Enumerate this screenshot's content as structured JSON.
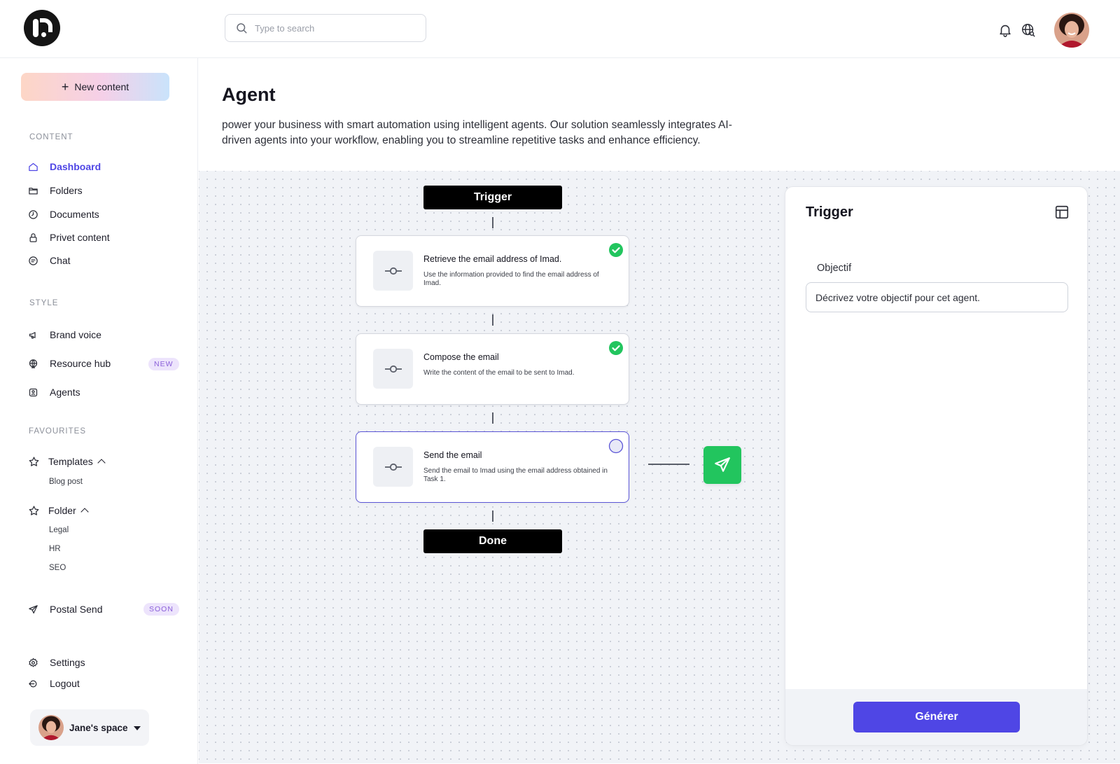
{
  "search": {
    "placeholder": "Type to search"
  },
  "sidebar": {
    "new_content_label": "New content",
    "sections": {
      "content": "CONTENT",
      "style": "STYLE",
      "favourites": "FAVOURITES"
    },
    "content_items": [
      "Dashboard",
      "Folders",
      "Documents",
      "Privet content",
      "Chat"
    ],
    "style_items": [
      "Brand voice",
      "Resource hub",
      "Agents"
    ],
    "resource_hub_badge": "NEW",
    "favourites": {
      "templates": {
        "label": "Templates",
        "children": [
          "Blog post"
        ]
      },
      "folder": {
        "label": "Folder",
        "children": [
          "Legal",
          "HR",
          "SEO"
        ]
      }
    },
    "postal_send": {
      "label": "Postal Send",
      "badge": "SOON"
    },
    "settings_label": "Settings",
    "logout_label": "Logout",
    "space_name": "Jane's space"
  },
  "main": {
    "title": "Agent",
    "description": "power your business with smart automation using intelligent agents. Our solution seamlessly integrates AI-driven agents into your workflow, enabling you to streamline repetitive tasks and enhance efficiency."
  },
  "workflow": {
    "trigger_label": "Trigger",
    "done_label": "Done",
    "steps": [
      {
        "title": "Retrieve the email address of Imad.",
        "description": "Use the information provided to find the email address of Imad.",
        "status": "complete"
      },
      {
        "title": "Compose the email",
        "description": "Write the content of the email to be sent to Imad.",
        "status": "complete"
      },
      {
        "title": "Send the email",
        "description": "Send the email to Imad using the email address obtained in Task 1.",
        "status": "pending"
      }
    ],
    "action_icon": "send-icon",
    "colors": {
      "accent": "#4f46e5",
      "success": "#22c55e"
    }
  },
  "panel": {
    "title": "Trigger",
    "field_label": "Objectif",
    "field_placeholder": "Décrivez votre objectif pour cet agent.",
    "generate_label": "Générer"
  }
}
